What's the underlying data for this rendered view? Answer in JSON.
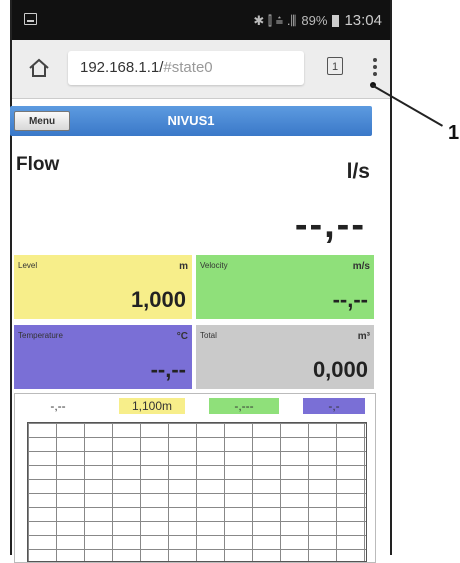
{
  "status_bar": {
    "signal_text": "✱ ⫿ ⩮ .⫼",
    "battery_percent": "89%",
    "time": "13:04"
  },
  "browser": {
    "url_host": "192.168.1.1/",
    "url_hash": "#state0",
    "tab_count": "1"
  },
  "app": {
    "menu_label": "Menu",
    "title": "NIVUS1"
  },
  "flow": {
    "label": "Flow",
    "unit": "l/s",
    "value": "--,--"
  },
  "tiles": {
    "level": {
      "label": "Level",
      "unit": "m",
      "value": "1,000"
    },
    "velocity": {
      "label": "Velocity",
      "unit": "m/s",
      "value": "--,--"
    },
    "temperature": {
      "label": "Temperature",
      "unit": "°C",
      "value": "--,--"
    },
    "total": {
      "label": "Total",
      "unit": "m³",
      "value": "0,000"
    }
  },
  "chart_legend": [
    "-,--",
    "1,100m",
    "-,---",
    "-,-"
  ],
  "annotation": {
    "number": "1"
  },
  "colors": {
    "appbar": "#3a78c8",
    "level": "#f7ee8a",
    "velocity": "#8fe07a",
    "temperature": "#7a6fd6",
    "total": "#cacaca"
  }
}
